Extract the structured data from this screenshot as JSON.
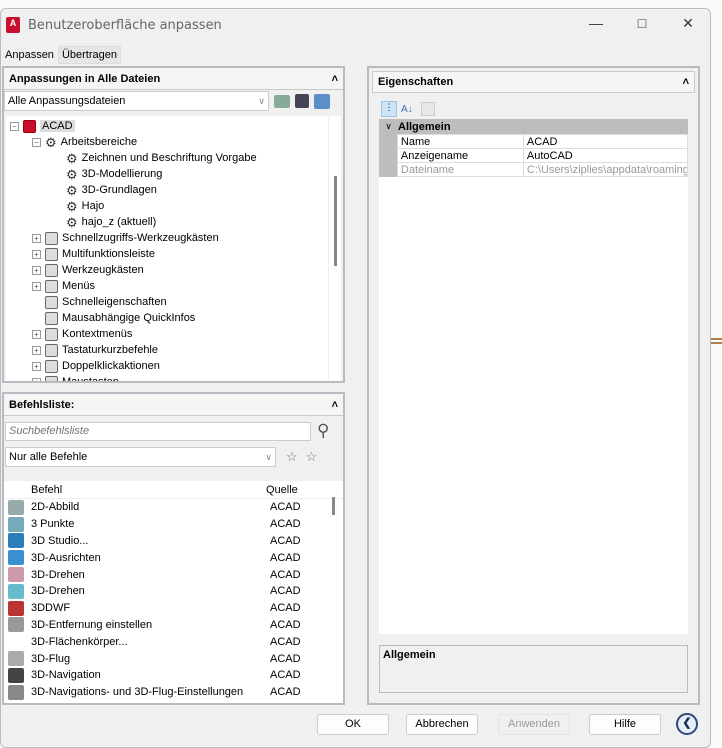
{
  "window": {
    "title": "Benutzeroberfläche anpassen",
    "logo": "A"
  },
  "tabs": [
    "Anpassen",
    "Übertragen"
  ],
  "customizations": {
    "header": "Anpassungen in Alle Dateien",
    "file_combo": "Alle Anpassungsdateien",
    "tree": [
      {
        "label": "ACAD",
        "level": 0,
        "expander": "-"
      },
      {
        "label": "Arbeitsbereiche",
        "level": 1,
        "expander": "-"
      },
      {
        "label": "Zeichnen und Beschriftung Vorgabe",
        "level": 2
      },
      {
        "label": "3D-Modellierung",
        "level": 2
      },
      {
        "label": "3D-Grundlagen",
        "level": 2
      },
      {
        "label": "Hajo",
        "level": 2
      },
      {
        "label": "hajo_z (aktuell)",
        "level": 2
      },
      {
        "label": "Schnellzugriffs-Werkzeugkästen",
        "level": 1,
        "expander": "+"
      },
      {
        "label": "Multifunktionsleiste",
        "level": 1,
        "expander": "+"
      },
      {
        "label": "Werkzeugkästen",
        "level": 1,
        "expander": "+"
      },
      {
        "label": "Menüs",
        "level": 1,
        "expander": "+"
      },
      {
        "label": "Schnelleigenschaften",
        "level": 1
      },
      {
        "label": "Mausabhängige QuickInfos",
        "level": 1
      },
      {
        "label": "Kontextmenüs",
        "level": 1,
        "expander": "+"
      },
      {
        "label": "Tastaturkurzbefehle",
        "level": 1,
        "expander": "+"
      },
      {
        "label": "Doppelklickaktionen",
        "level": 1,
        "expander": "+"
      },
      {
        "label": "Maustasten",
        "level": 1,
        "expander": "+"
      }
    ]
  },
  "commands": {
    "header": "Befehlsliste:",
    "search_placeholder": "Suchbefehlsliste",
    "filter": "Nur alle Befehle",
    "columns": [
      "Befehl",
      "Quelle"
    ],
    "rows": [
      {
        "name": "2D-Abbild",
        "source": "ACAD",
        "color": "#9aa"
      },
      {
        "name": "3 Punkte",
        "source": "ACAD",
        "color": "#7ab"
      },
      {
        "name": "3D Studio...",
        "source": "ACAD",
        "color": "#2b7fb8"
      },
      {
        "name": "3D-Ausrichten",
        "source": "ACAD",
        "color": "#3b8ed0"
      },
      {
        "name": "3D-Drehen",
        "source": "ACAD",
        "color": "#c9a"
      },
      {
        "name": "3D-Drehen",
        "source": "ACAD",
        "color": "#6bc"
      },
      {
        "name": "3DDWF",
        "source": "ACAD",
        "color": "#b33"
      },
      {
        "name": "3D-Entfernung einstellen",
        "source": "ACAD",
        "color": "#999"
      },
      {
        "name": "3D-Flächenkörper...",
        "source": "ACAD",
        "color": ""
      },
      {
        "name": "3D-Flug",
        "source": "ACAD",
        "color": "#aaa"
      },
      {
        "name": "3D-Navigation",
        "source": "ACAD",
        "color": "#444"
      },
      {
        "name": "3D-Navigations- und 3D-Flug-Einstellungen",
        "source": "ACAD",
        "color": "#888"
      }
    ]
  },
  "properties": {
    "header": "Eigenschaften",
    "section": "Allgemein",
    "rows": [
      {
        "key": "Name",
        "value": "ACAD"
      },
      {
        "key": "Anzeigename",
        "value": "AutoCAD"
      },
      {
        "key": "Dateiname",
        "value": "C:\\Users\\ziplies\\appdata\\roaming",
        "disabled": true
      }
    ],
    "description_title": "Allgemein"
  },
  "buttons": {
    "ok": "OK",
    "cancel": "Abbrechen",
    "apply": "Anwenden",
    "help": "Hilfe"
  }
}
